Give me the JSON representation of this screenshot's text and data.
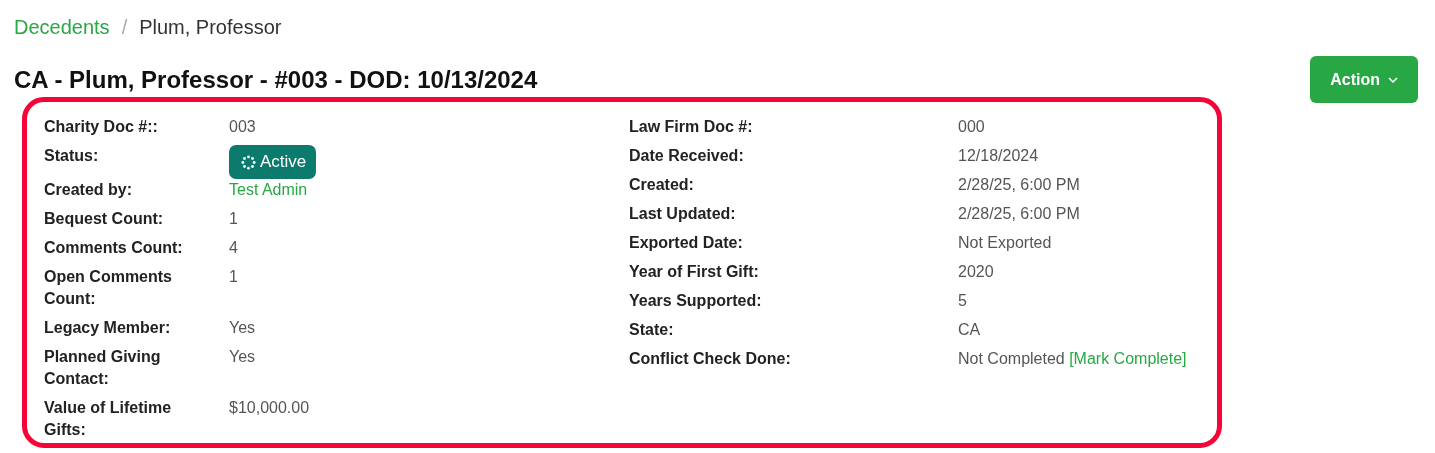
{
  "breadcrumb_separator": "/",
  "breadcrumb": [
    {
      "label": "Decedents",
      "kind": "link"
    },
    {
      "label": "Plum, Professor",
      "kind": "current"
    }
  ],
  "title": "CA - Plum, Professor - #003 - DOD: 10/13/2024",
  "action_button": {
    "label": "Action"
  },
  "details": {
    "left": [
      {
        "label": "Charity Doc #::",
        "value": "003",
        "kind": "text"
      },
      {
        "label": "Status:",
        "value": "Active",
        "kind": "badge"
      },
      {
        "label": "Created by:",
        "value": "Test Admin",
        "kind": "link"
      },
      {
        "label": "Bequest Count:",
        "value": "1",
        "kind": "text"
      },
      {
        "label": "Comments Count:",
        "value": "4",
        "kind": "text"
      },
      {
        "label": "Open Comments Count:",
        "value": "1",
        "kind": "text"
      },
      {
        "label": "Legacy Member:",
        "value": "Yes",
        "kind": "text"
      },
      {
        "label": "Planned Giving Contact:",
        "value": "Yes",
        "kind": "text"
      },
      {
        "label": "Value of Lifetime Gifts:",
        "value": "$10,000.00",
        "kind": "text"
      }
    ],
    "right": [
      {
        "label": "Law Firm Doc #:",
        "value": "000",
        "kind": "text"
      },
      {
        "label": "Date Received:",
        "value": "12/18/2024",
        "kind": "text"
      },
      {
        "label": "Created:",
        "value": "2/28/25, 6:00 PM",
        "kind": "text"
      },
      {
        "label": "Last Updated:",
        "value": "2/28/25, 6:00 PM",
        "kind": "text"
      },
      {
        "label": "Exported Date:",
        "value": "Not Exported",
        "kind": "text"
      },
      {
        "label": "Year of First Gift:",
        "value": "2020",
        "kind": "text"
      },
      {
        "label": "Years Supported:",
        "value": "5",
        "kind": "text"
      },
      {
        "label": "State:",
        "value": "CA",
        "kind": "text"
      },
      {
        "label": "Conflict Check Done:",
        "value": "Not Completed",
        "kind": "text",
        "action": "[Mark Complete]"
      }
    ]
  }
}
